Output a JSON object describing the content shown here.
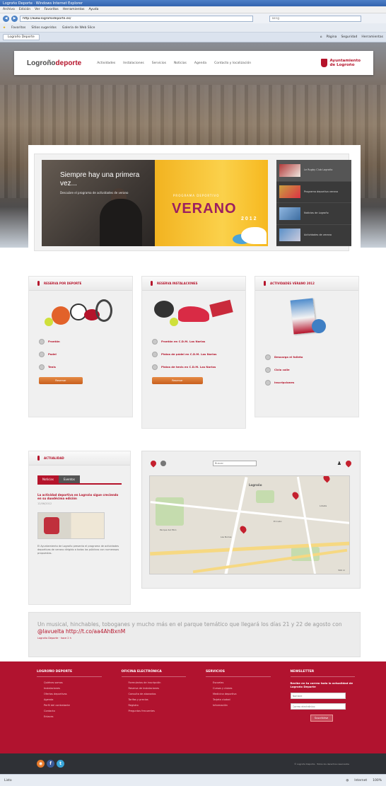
{
  "browser": {
    "title": "Logroño Deporte · Windows Internet Explorer",
    "menu": [
      "Archivo",
      "Edición",
      "Ver",
      "Favoritos",
      "Herramientas",
      "Ayuda"
    ],
    "url": "http://www.logroñodeporte.es/",
    "search_placeholder": "Bing",
    "favorites_label": "Favoritos",
    "favorites_items": [
      "Sitios sugeridos",
      "Galería de Web Slice"
    ],
    "tab_label": "Logroño Deporte",
    "tools": [
      "Página",
      "Seguridad",
      "Herramientas"
    ],
    "status_left": "Listo",
    "status_zone": "Internet",
    "zoom": "100%"
  },
  "header": {
    "logo_part1": "Logroño",
    "logo_part2": "deporte",
    "nav": [
      "Actividades",
      "Instalaciones",
      "Servicios",
      "Noticias",
      "Agenda",
      "Contacto y localización"
    ],
    "ayto_line1": "Ayuntamiento",
    "ayto_line2": "de Logroño"
  },
  "slider": {
    "headline": "Siempre hay una primera vez...",
    "subtitle": "Descubre el programa de actividades de verano",
    "programa": "PROGRAMA DEPORTIVO",
    "verano": "VERANO",
    "year": "2012",
    "items": [
      "Le Rugby Club Logroño",
      "Programa deportivo verano",
      "Noticias de Logroño",
      "Actividades de verano"
    ]
  },
  "box_sport": {
    "title": "Reserva por deporte",
    "links": [
      "Frontón",
      "Padel",
      "Tenis"
    ],
    "button": "Reservar"
  },
  "box_install": {
    "title": "Reserva instalaciones",
    "links": [
      "Frontón en C.D.M. Las Norias",
      "Pistas de pádel en C.D.M. Las Norias",
      "Pistas de tenis en C.D.M. Las Norias"
    ],
    "button": "Reservar"
  },
  "box_summer": {
    "title": "Actividades verano 2012",
    "links": [
      "Descarga el folleto",
      "Ciclo calle",
      "Inscripciones"
    ]
  },
  "news": {
    "title": "Actualidad",
    "tabs": [
      "Noticias",
      "Eventos"
    ],
    "headline": "La actividad deportiva en Logroño sigue creciendo en su duodécima edición",
    "date": "12/06/2012",
    "body": "El Ayuntamiento de Logroño presenta el programa de actividades deportivas de verano dirigido a todos los públicos con numerosas propuestas."
  },
  "map": {
    "search_placeholder": "Buscar",
    "city_label": "Logroño",
    "labels": [
      "Logroño",
      "Parque del Ebro",
      "Las Norias",
      "El Cubo",
      "Lobete"
    ],
    "scale": "500 m"
  },
  "tweet": {
    "text": "Un musical, hinchables, toboganes y mucho más en el parque temático que llegará los días 21 y 22 de agosto con",
    "mention": "@lavuelta",
    "link": "http://t.co/aa4AhBxnM",
    "by": "Logroño Deporte · hace 2 h"
  },
  "footer": {
    "col1_title": "Logroño Deporte",
    "col1_links": [
      "Quiénes somos",
      "Instalaciones",
      "Ofertas deportivas",
      "Agenda",
      "Perfil del contratante",
      "Contacto",
      "Enlaces"
    ],
    "col2_title": "Oficina Electrónica",
    "col2_links": [
      "Formularios de inscripción",
      "Reserva de instalaciones",
      "Consulta de abonados",
      "Tarifas y precios",
      "Registro",
      "Preguntas frecuentes"
    ],
    "col3_title": "Servicios",
    "col3_links": [
      "Escuelas",
      "Cursos y clubes",
      "Medicina deportiva",
      "Tarjeta ciudad",
      "Información"
    ],
    "newsletter_title": "Newsletter",
    "newsletter_text": "Recibe en tu correo toda la actualidad de Logroño Deporte",
    "nl_name_placeholder": "Nombre",
    "nl_email_placeholder": "Correo electrónico",
    "nl_button": "Suscribirse",
    "copyright": "© Logroño Deporte · Todos los derechos reservados"
  },
  "colors": {
    "brand_red": "#b5142b",
    "footer_red": "#b1132f",
    "dark": "#2f3136"
  }
}
